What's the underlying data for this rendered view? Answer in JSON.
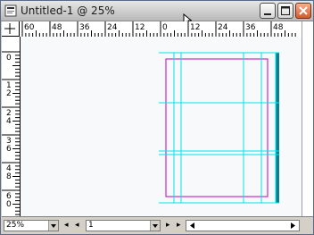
{
  "window": {
    "title": "Untitled-1 @ 25%",
    "controls": [
      "minimize",
      "maximize",
      "close"
    ]
  },
  "ruler": {
    "horizontal_labels": [
      "60",
      "48",
      "36",
      "24",
      "12",
      "0",
      "12",
      "24",
      "36",
      "48"
    ],
    "vertical_labels": [
      "0",
      "1 2",
      "2 4",
      "3 6",
      "4 8",
      "6 0"
    ]
  },
  "statusbar": {
    "zoom": "25",
    "page": "1"
  },
  "colors": {
    "guide": "#00e5ee",
    "margin": "#c000c0",
    "page_shadow": "#0a7f8f",
    "canvas": "#f7f9fb"
  }
}
